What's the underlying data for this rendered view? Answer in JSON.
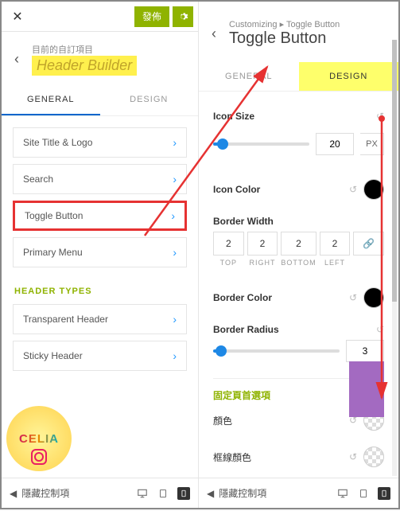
{
  "left": {
    "publish_label": "發佈",
    "breadcrumb_small": "目前的自訂項目",
    "page_title": "Header Builder",
    "tabs": {
      "general": "GENERAL",
      "design": "DESIGN"
    },
    "items": [
      {
        "label": "Site Title & Logo"
      },
      {
        "label": "Search"
      },
      {
        "label": "Toggle Button"
      },
      {
        "label": "Primary Menu"
      }
    ],
    "section_header_types": "HEADER TYPES",
    "header_type_items": [
      {
        "label": "Transparent Header"
      },
      {
        "label": "Sticky Header"
      }
    ],
    "footer_text": "隱藏控制項"
  },
  "right": {
    "breadcrumb": "Customizing ▸ Toggle Button",
    "page_title": "Toggle Button",
    "tabs": {
      "general": "GENERAL",
      "design": "DESIGN"
    },
    "icon_size_label": "Icon Size",
    "icon_size_value": "20",
    "icon_size_unit": "PX",
    "icon_color_label": "Icon Color",
    "border_width_label": "Border Width",
    "border_values": {
      "top": "2",
      "right": "2",
      "bottom": "2",
      "left": "2"
    },
    "border_labels": {
      "top": "TOP",
      "right": "RIGHT",
      "bottom": "BOTTOM",
      "left": "LEFT"
    },
    "link_icon": "🔗",
    "border_color_label": "Border Color",
    "border_radius_label": "Border Radius",
    "border_radius_value": "3",
    "sticky_header_section": "固定頁首選項",
    "color_label": "顏色",
    "frame_color_label": "框線顏色",
    "footer_text": "隱藏控制項"
  },
  "logo_text": "CELIA"
}
